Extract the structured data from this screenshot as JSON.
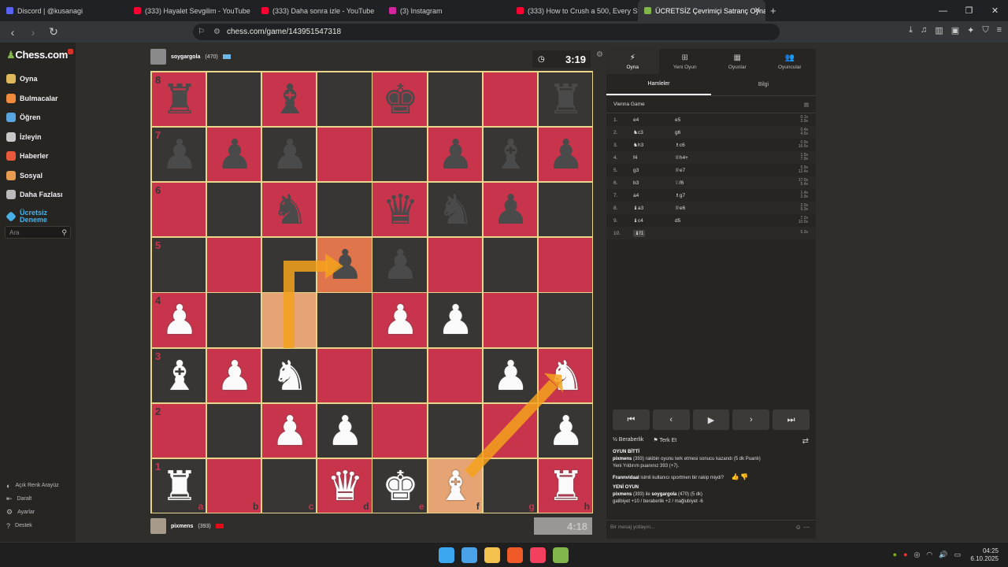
{
  "browser": {
    "tabs": [
      {
        "title": "Discord | @kusanagi",
        "color": "#5865f2"
      },
      {
        "title": "(333) Hayalet Sevgilim - YouTube",
        "color": "#ff0033"
      },
      {
        "title": "(333) Daha sonra izle - YouTube",
        "color": "#ff0033"
      },
      {
        "title": "(3) Instagram",
        "color": "#d6249f"
      },
      {
        "title": "(333) How to Crush a 500, Every Step",
        "color": "#ff0033"
      },
      {
        "title": "ÜCRETSİZ Çevrimiçi Satranç Oyna",
        "color": "#81b64c"
      }
    ],
    "url": "chess.com/game/143951547318"
  },
  "sidebar": {
    "logo": "Chess.com",
    "items": [
      {
        "label": "Oyna",
        "color": "#e0b85c"
      },
      {
        "label": "Bulmacalar",
        "color": "#f08a3c"
      },
      {
        "label": "Öğren",
        "color": "#59a5e0"
      },
      {
        "label": "İzleyin",
        "color": "#c8c8c8"
      },
      {
        "label": "Haberler",
        "color": "#e8583c"
      },
      {
        "label": "Sosyal",
        "color": "#e89c50"
      },
      {
        "label": "Daha Fazlası",
        "color": "#bbbbbb"
      }
    ],
    "free_trial": "Ücretsiz Deneme",
    "search_placeholder": "Ara",
    "bottom": [
      "Açık Renk Arayüz",
      "Daralt",
      "Ayarlar",
      "Destek"
    ]
  },
  "game": {
    "top_player": {
      "name": "soygargola",
      "rating": "(470)"
    },
    "bottom_player": {
      "name": "pixmens",
      "rating": "(393)"
    },
    "top_clock": "3:19",
    "bottom_clock": "4:18",
    "ranks": [
      "8",
      "7",
      "6",
      "5",
      "4",
      "3",
      "2",
      "1"
    ],
    "files": [
      "a",
      "b",
      "c",
      "d",
      "e",
      "f",
      "g",
      "h"
    ],
    "position": [
      [
        "bR",
        "",
        "bB",
        "",
        "bK",
        "",
        "",
        "bR"
      ],
      [
        "bP",
        "bP",
        "bP",
        "",
        "",
        "bP",
        "bB",
        "bP"
      ],
      [
        "",
        "",
        "bN",
        "",
        "bQ",
        "bN",
        "bP",
        ""
      ],
      [
        "",
        "",
        "",
        "bP",
        "bP",
        "",
        "",
        ""
      ],
      [
        "wP",
        "",
        "",
        "",
        "wP",
        "wP",
        "",
        ""
      ],
      [
        "wB",
        "wP",
        "wN",
        "",
        "",
        "",
        "wP",
        "wN"
      ],
      [
        "",
        "",
        "wP",
        "wP",
        "",
        "",
        "",
        "wP"
      ],
      [
        "wR",
        "",
        "",
        "wQ",
        "wK",
        "wB",
        "",
        "wR"
      ]
    ]
  },
  "panel": {
    "tabs": [
      "Oyna",
      "Yeni Oyun",
      "Oyunlar",
      "Oyuncular"
    ],
    "subtabs": [
      "Hamleler",
      "Bilgi"
    ],
    "opening": "Vienna Game",
    "moves": [
      {
        "n": "1.",
        "w": "e4",
        "b": "e5",
        "tw": "0.1s",
        "tb": "2.9s"
      },
      {
        "n": "2.",
        "w": "♞c3",
        "b": "g6",
        "tw": "0.4s",
        "tb": "4.5s"
      },
      {
        "n": "3.",
        "w": "♞h3",
        "b": "♗c6",
        "tw": "0.9s",
        "tb": "16.5s"
      },
      {
        "n": "4.",
        "w": "f4",
        "b": "♕h4+",
        "tw": "1.5s",
        "tb": "7.9s"
      },
      {
        "n": "5.",
        "w": "g3",
        "b": "♕e7",
        "tw": "5.9s",
        "tb": "12.4s"
      },
      {
        "n": "6.",
        "w": "b3",
        "b": "♘f6",
        "tw": "17.0s",
        "tb": "5.4s"
      },
      {
        "n": "7.",
        "w": "a4",
        "b": "♗g7",
        "tw": "1.4s",
        "tb": "2.9s"
      },
      {
        "n": "8.",
        "w": "♝a3",
        "b": "♕e6",
        "tw": "2.0s",
        "tb": "9.3s"
      },
      {
        "n": "9.",
        "w": "♝c4",
        "b": "d5",
        "tw": "7.2s",
        "tb": "10.0s"
      },
      {
        "n": "10.",
        "w": "♝f1",
        "b": "",
        "tw": "5.3s",
        "tb": ""
      }
    ],
    "draw": "Beraberlik",
    "resign": "Terk Et",
    "log_title": "OYUN BİTTİ",
    "log1a": "pixmens",
    "log1b": " (393) rakibin oyunu terk etmesi sonucu kazandı (5 dk Puanlı)",
    "log2": "Yeni Yıldırım puanınız 393 (+7).",
    "log3a": "Frannvidaal",
    "log3b": " isimli kullanıcı sportmen bir rakip miydi?",
    "log4": "YENİ OYUN",
    "log5a": "pixmens",
    "log5b": " (393) ile ",
    "log5c": "soygargola",
    "log5d": " (470) (5 dk)",
    "log6": "galibiyet +10 / beraberlik +2 / mağlubiyet -6",
    "chat_placeholder": "Bir mesaj yollayın..."
  },
  "taskbar": {
    "time": "04:25",
    "date": "6.10.2025"
  }
}
